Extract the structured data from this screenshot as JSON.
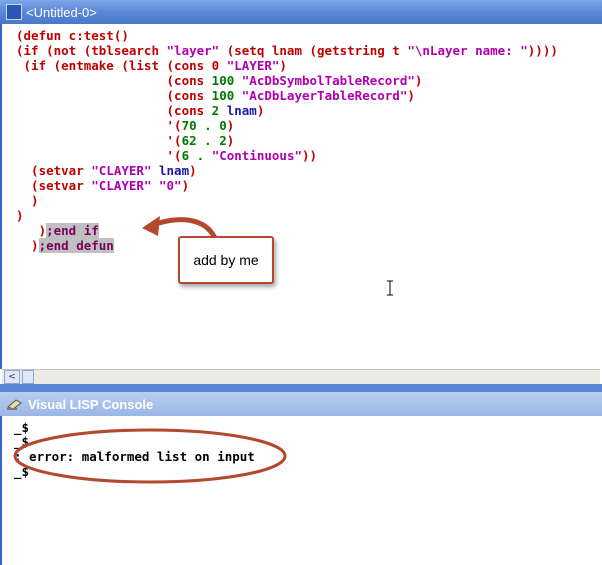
{
  "window": {
    "title": "<Untitled-0>"
  },
  "code_lines": [
    [
      [
        "p",
        "(defun c:test()"
      ]
    ],
    [
      [
        "p",
        "(if (not (tblsearch "
      ],
      [
        "s",
        "\"layer\""
      ],
      [
        "p",
        " (setq lnam (getstring t "
      ],
      [
        "s",
        "\"\\nLayer name: \""
      ],
      [
        "p",
        ")))) "
      ]
    ],
    [
      [
        "p",
        " (if (entmake (list (cons 0 "
      ],
      [
        "s",
        "\"LAYER\""
      ],
      [
        "p",
        ")"
      ]
    ],
    [
      [
        "p",
        "                    (cons "
      ],
      [
        "n",
        "100 "
      ],
      [
        "s",
        "\"AcDbSymbolTableRecord\""
      ],
      [
        "p",
        ")"
      ]
    ],
    [
      [
        "p",
        "                    (cons "
      ],
      [
        "n",
        "100 "
      ],
      [
        "s",
        "\"AcDbLayerTableRecord\""
      ],
      [
        "p",
        ")"
      ]
    ],
    [
      [
        "p",
        "                    (cons "
      ],
      [
        "n",
        "2 "
      ],
      [
        "k",
        "lnam"
      ],
      [
        "p",
        ")"
      ]
    ],
    [
      [
        "p",
        "                    '("
      ],
      [
        "n",
        "70 . 0"
      ],
      [
        "p",
        ")"
      ]
    ],
    [
      [
        "p",
        "                    '("
      ],
      [
        "n",
        "62 . 2"
      ],
      [
        "p",
        ")"
      ]
    ],
    [
      [
        "p",
        "                    '("
      ],
      [
        "n",
        "6 . "
      ],
      [
        "s",
        "\"Continuous\""
      ],
      [
        "p",
        "))"
      ]
    ],
    [
      [
        "p",
        "  (setvar "
      ],
      [
        "s",
        "\"CLAYER\""
      ],
      [
        "k",
        " lnam"
      ],
      [
        "p",
        ")"
      ]
    ],
    [
      [
        "p",
        "  (setvar "
      ],
      [
        "s",
        "\"CLAYER\" \"0\""
      ],
      [
        "p",
        ")"
      ]
    ],
    [
      [
        "p",
        "  )"
      ]
    ],
    [
      [
        "p",
        ")"
      ]
    ],
    [
      [
        "p",
        "   )"
      ],
      [
        "c",
        ";end if"
      ]
    ],
    [
      [
        "p",
        "  )"
      ],
      [
        "c",
        ";end defun"
      ]
    ]
  ],
  "annotation": {
    "label": "add by me"
  },
  "console": {
    "title": "Visual LISP Console",
    "lines": [
      "_$",
      "_$",
      "; error: malformed list on input",
      "_$"
    ]
  },
  "scroll": {
    "left_arrow": "<"
  },
  "colors": {
    "highlight_circle": "#b4482e",
    "arrow": "#b4482e"
  }
}
